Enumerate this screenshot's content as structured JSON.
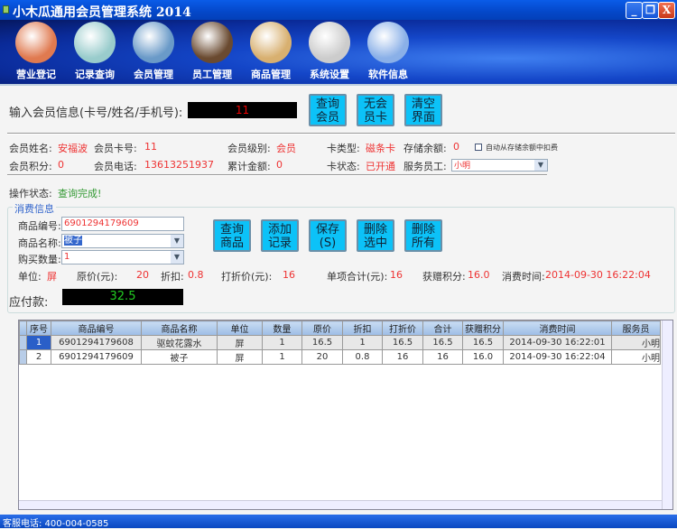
{
  "window": {
    "title": "小木瓜通用会员管理系统 2014",
    "minimize": "_",
    "restore": "❐",
    "close": "X"
  },
  "toolbar": [
    {
      "label": "营业登记",
      "icon": "receptionist-icon",
      "color": "#e07a50"
    },
    {
      "label": "记录查询",
      "icon": "magnifier-icon",
      "color": "#9cc"
    },
    {
      "label": "会员管理",
      "icon": "members-icon",
      "color": "#6a9ac8"
    },
    {
      "label": "员工管理",
      "icon": "employee-icon",
      "color": "#6a4a30"
    },
    {
      "label": "商品管理",
      "icon": "box-icon",
      "color": "#d8b070"
    },
    {
      "label": "系统设置",
      "icon": "gear-icon",
      "color": "#ccc"
    },
    {
      "label": "软件信息",
      "icon": "globe-icon",
      "color": "#8ab0e8"
    }
  ],
  "search": {
    "label": "输入会员信息(卡号/姓名/手机号):",
    "value": "11",
    "buttons": [
      "查询会员",
      "无会员卡",
      "清空界面"
    ]
  },
  "member": {
    "name_label": "会员姓名:",
    "name": "安福波",
    "card_label": "会员卡号:",
    "card": "11",
    "level_label": "会员级别:",
    "level": "会员",
    "cardtype_label": "卡类型:",
    "cardtype": "磁条卡",
    "balance_label": "存储余额:",
    "balance": "0",
    "auto_label": "自动从存储余额中扣费",
    "points_label": "会员积分:",
    "points": "0",
    "phone_label": "会员电话:",
    "phone": "13613251937",
    "total_label": "累计金额:",
    "total": "0",
    "status_label": "卡状态:",
    "status": "已开通",
    "staff_label": "服务员工:",
    "staff": "小明"
  },
  "op": {
    "label": "操作状态:",
    "value": "查询完成!"
  },
  "consume": {
    "legend": "消费信息",
    "code_label": "商品编号:",
    "code": "6901294179609",
    "name_label": "商品名称:",
    "name": "被子",
    "qty_label": "购买数量:",
    "qty": "1",
    "buttons": [
      "查询商品",
      "添加记录",
      "保存(S)",
      "删除选中",
      "删除所有"
    ],
    "unit_label": "单位:",
    "unit": "屏",
    "price_label": "原价(元):",
    "price": "20",
    "disc_label": "折扣:",
    "disc": "0.8",
    "dprice_label": "打折价(元):",
    "dprice": "16",
    "sub_label": "单项合计(元):",
    "sub": "16",
    "pts_label": "获赠积分:",
    "pts": "16.0",
    "time_label": "消费时间:",
    "time": "2014-09-30 16:22:04",
    "due_label": "应付款:",
    "due": "32.5"
  },
  "grid": {
    "headers": [
      "序号",
      "商品编号",
      "商品名称",
      "单位",
      "数量",
      "原价",
      "折扣",
      "打折价",
      "合计",
      "获赠积分",
      "消费时间",
      "服务员"
    ],
    "rows": [
      [
        "1",
        "6901294179608",
        "驱蚊花露水",
        "屏",
        "1",
        "16.5",
        "1",
        "16.5",
        "16.5",
        "16.5",
        "2014-09-30 16:22:01",
        "小明"
      ],
      [
        "2",
        "6901294179609",
        "被子",
        "屏",
        "1",
        "20",
        "0.8",
        "16",
        "16",
        "16.0",
        "2014-09-30 16:22:04",
        "小明"
      ]
    ]
  },
  "statusbar": {
    "text": "客服电话: 400-004-0585"
  }
}
